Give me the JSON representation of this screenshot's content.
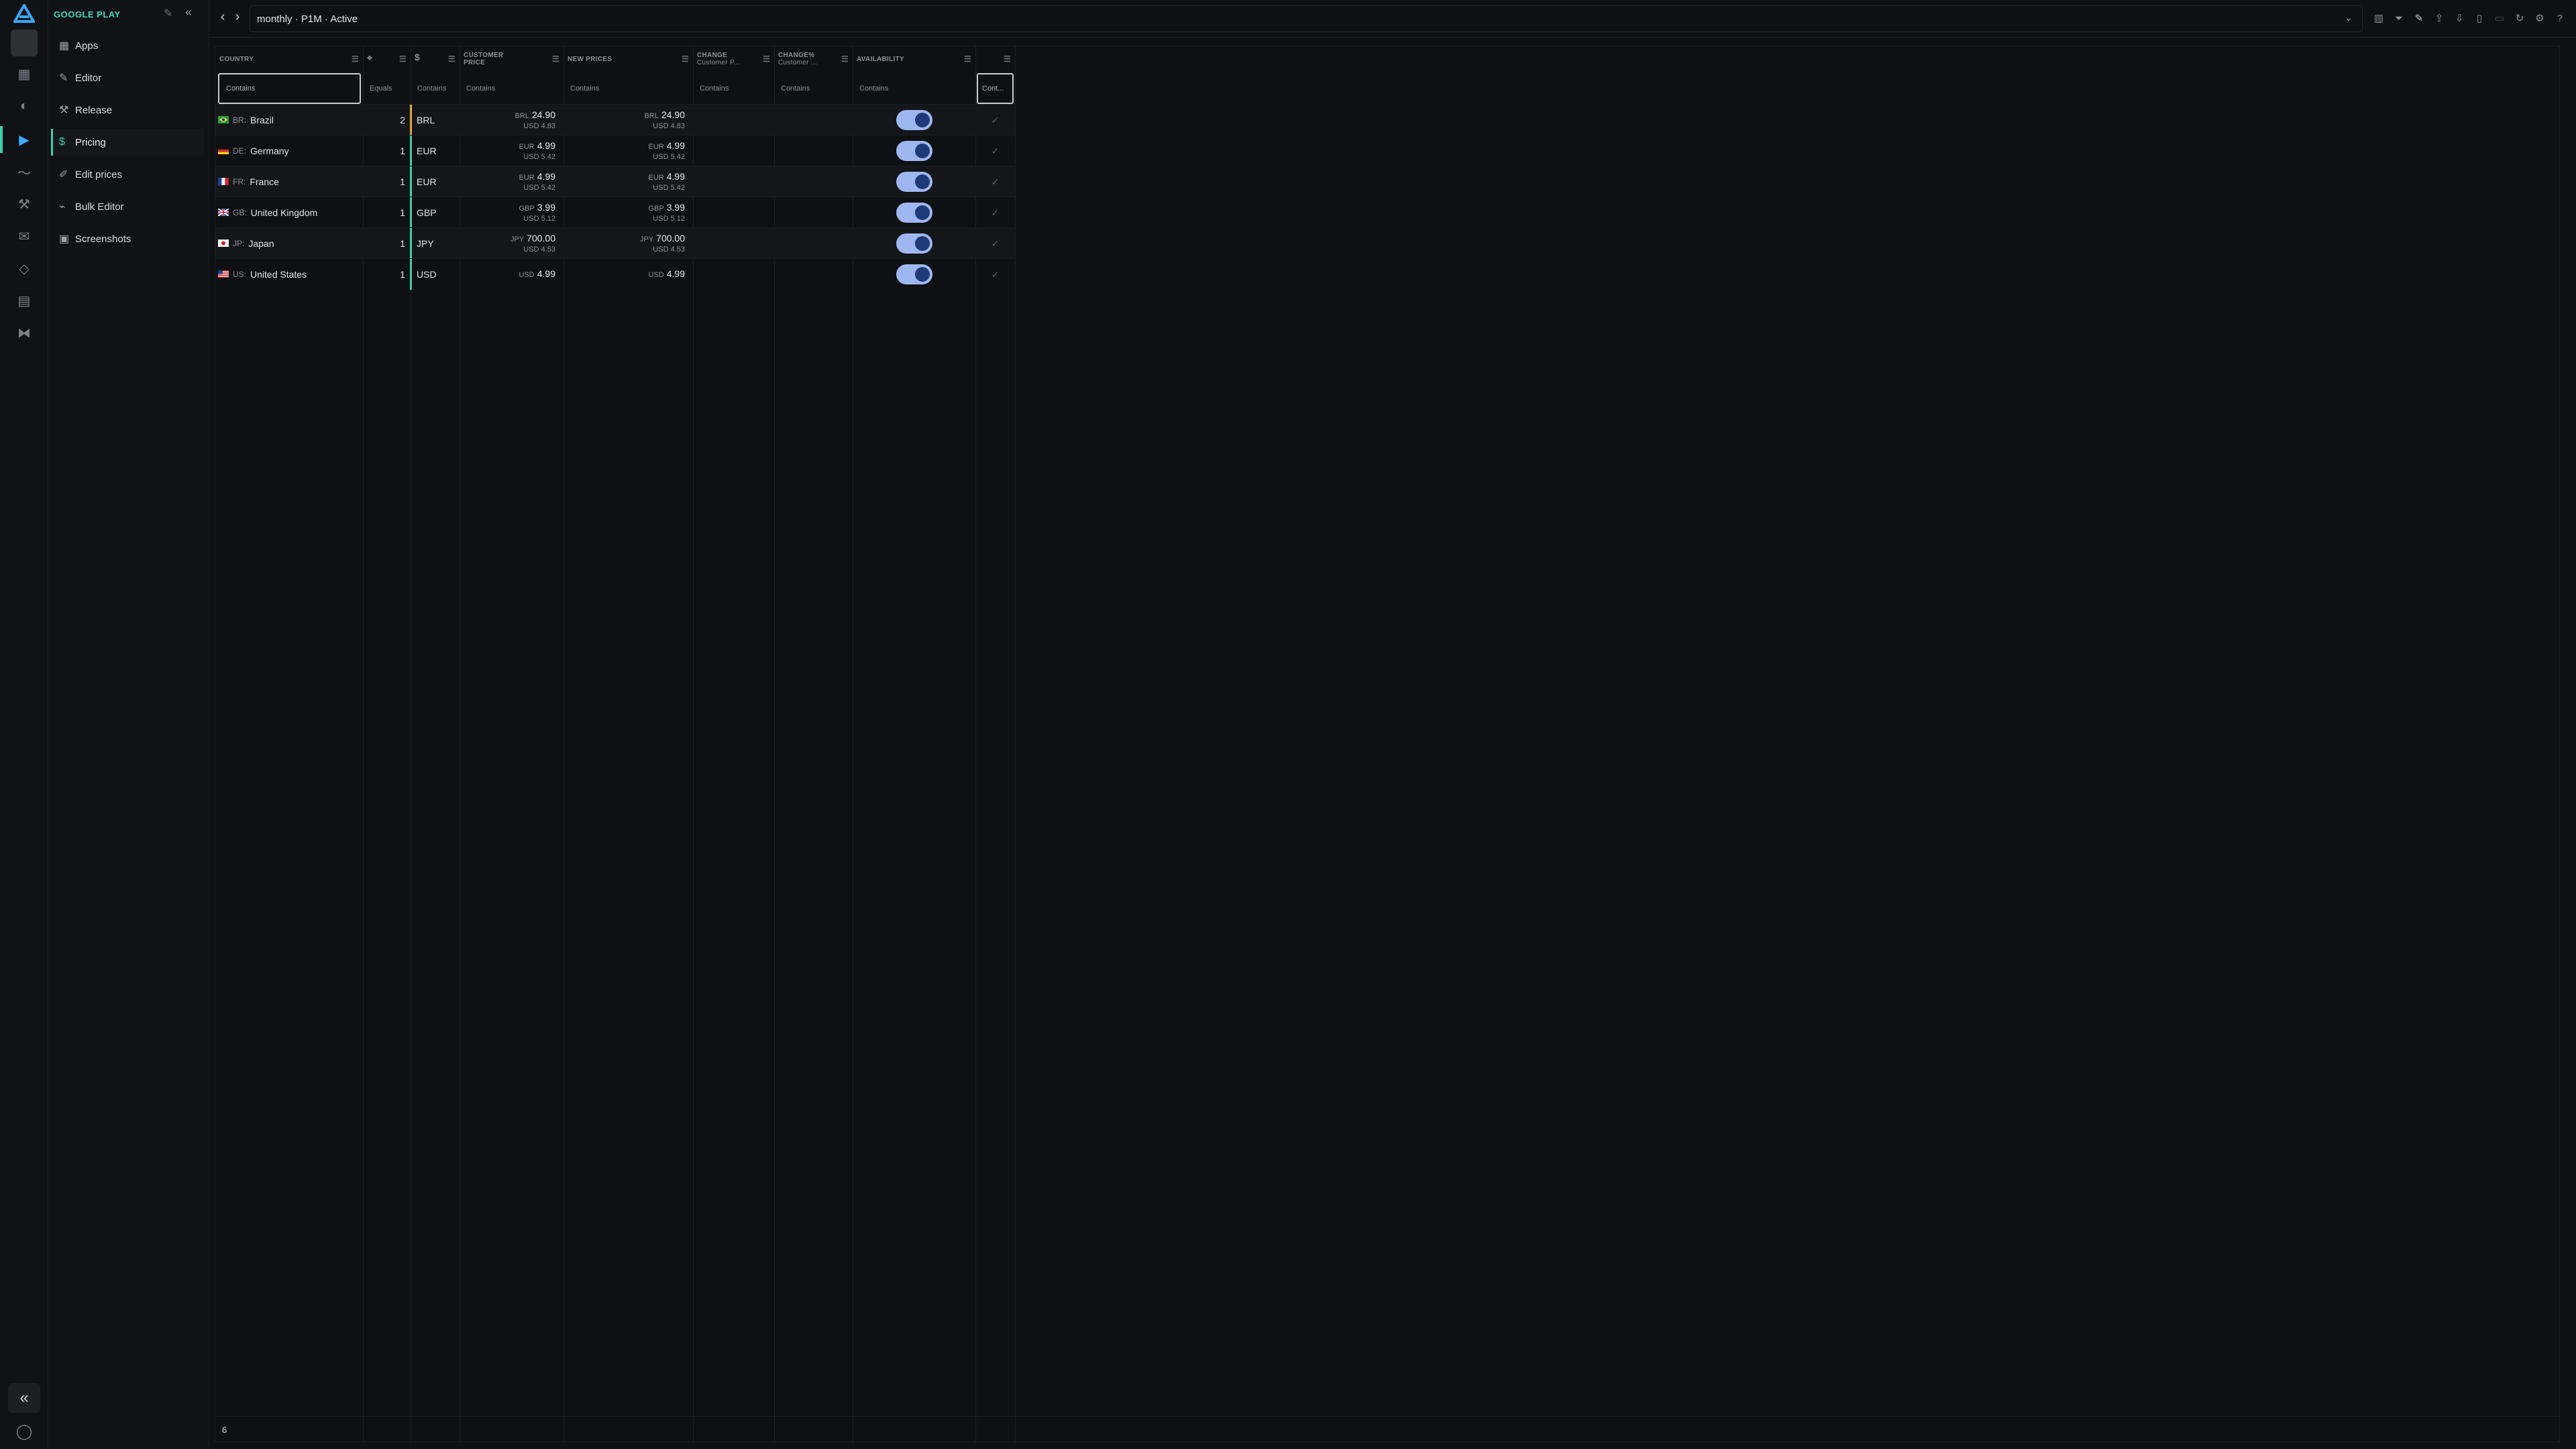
{
  "sidebar": {
    "brand": "GOOGLE PLAY",
    "items": [
      {
        "label": "Apps",
        "icon": "grid-icon"
      },
      {
        "label": "Editor",
        "icon": "pencil-icon"
      },
      {
        "label": "Release",
        "icon": "wrench-icon"
      },
      {
        "label": "Pricing",
        "icon": "dollar-icon",
        "active": true
      },
      {
        "label": "Edit prices",
        "icon": "edit-icon"
      },
      {
        "label": "Bulk Editor",
        "icon": "bulk-edit-icon"
      },
      {
        "label": "Screenshots",
        "icon": "image-icon"
      }
    ]
  },
  "topbar": {
    "selector_value": "monthly · P1M · Active"
  },
  "grid": {
    "headers": {
      "country": "COUNTRY",
      "customer_price": "CUSTOMER PRICE",
      "new_prices": "NEW PRICES",
      "change": "CHANGE",
      "change_sub": "Customer P...",
      "change_pct": "CHANGE%",
      "change_pct_sub": "Customer ...",
      "availability": "AVAILABILITY",
      "currency_symbol": "$"
    },
    "filters": {
      "country": "Contains",
      "tier": "Equals",
      "currency": "Contains",
      "customer_price": "Contains",
      "new_prices": "Contains",
      "change": "Contains",
      "change_pct": "Contains",
      "availability": "Contains",
      "last": "Cont..."
    },
    "rows": [
      {
        "code": "BR:",
        "country": "Brazil",
        "tier": "2",
        "currency": "BRL",
        "cp_cur": "BRL",
        "cp_val": "24.90",
        "cp_usd": "USD 4.83",
        "np_cur": "BRL",
        "np_val": "24.90",
        "np_usd": "USD 4.83",
        "available": true
      },
      {
        "code": "DE:",
        "country": "Germany",
        "tier": "1",
        "currency": "EUR",
        "cp_cur": "EUR",
        "cp_val": "4.99",
        "cp_usd": "USD 5.42",
        "np_cur": "EUR",
        "np_val": "4.99",
        "np_usd": "USD 5.42",
        "available": true
      },
      {
        "code": "FR:",
        "country": "France",
        "tier": "1",
        "currency": "EUR",
        "cp_cur": "EUR",
        "cp_val": "4.99",
        "cp_usd": "USD 5.42",
        "np_cur": "EUR",
        "np_val": "4.99",
        "np_usd": "USD 5.42",
        "available": true
      },
      {
        "code": "GB:",
        "country": "United Kingdom",
        "tier": "1",
        "currency": "GBP",
        "cp_cur": "GBP",
        "cp_val": "3.99",
        "cp_usd": "USD 5.12",
        "np_cur": "GBP",
        "np_val": "3.99",
        "np_usd": "USD 5.12",
        "available": true
      },
      {
        "code": "JP:",
        "country": "Japan",
        "tier": "1",
        "currency": "JPY",
        "cp_cur": "JPY",
        "cp_val": "700.00",
        "cp_usd": "USD 4.53",
        "np_cur": "JPY",
        "np_val": "700.00",
        "np_usd": "USD 4.53",
        "available": true
      },
      {
        "code": "US:",
        "country": "United States",
        "tier": "1",
        "currency": "USD",
        "cp_cur": "USD",
        "cp_val": "4.99",
        "cp_usd": "",
        "np_cur": "USD",
        "np_val": "4.99",
        "np_usd": "",
        "available": true
      }
    ],
    "row_count": "6"
  },
  "colors": {
    "accent": "#3ad0b0",
    "brand": "#46d7c2",
    "toggle_on": "#9fb7f0"
  }
}
